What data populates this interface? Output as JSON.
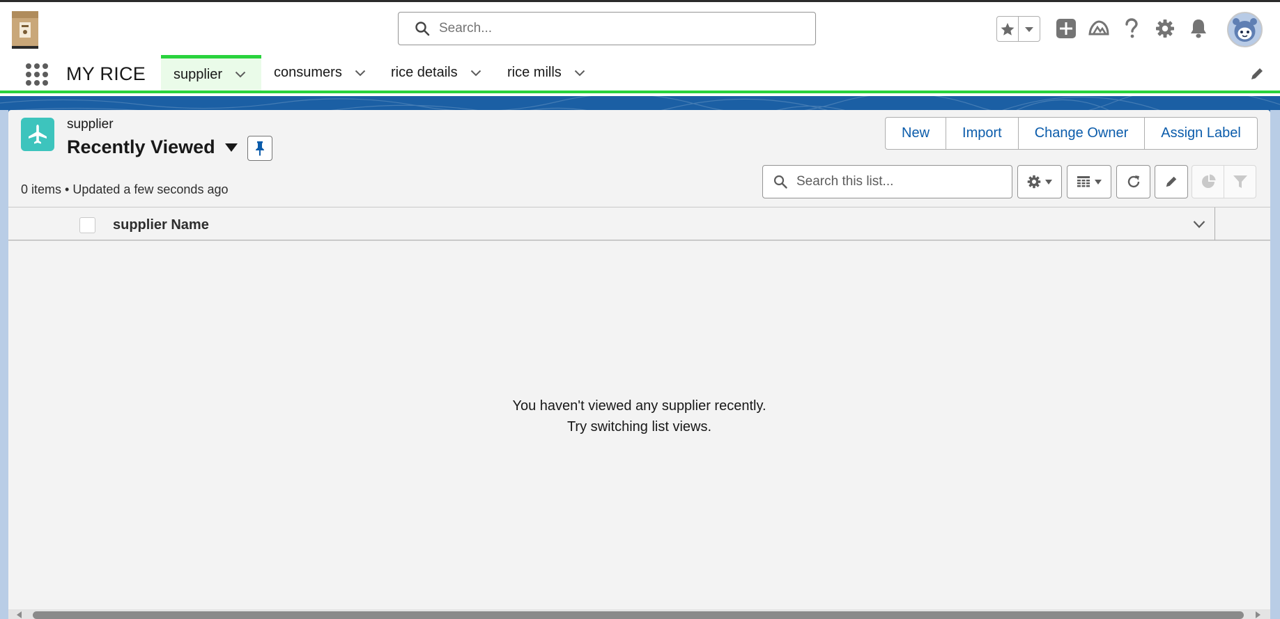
{
  "header": {
    "search_placeholder": "Search...",
    "icons": [
      "favorites-star-icon",
      "favorites-dropdown-icon",
      "global-add-icon",
      "trailhead-icon",
      "help-icon",
      "setup-gear-icon",
      "notifications-bell-icon",
      "user-avatar"
    ]
  },
  "app": {
    "name": "MY RICE",
    "tabs": [
      {
        "label": "supplier",
        "active": true
      },
      {
        "label": "consumers",
        "active": false
      },
      {
        "label": "rice details",
        "active": false
      },
      {
        "label": "rice mills",
        "active": false
      }
    ]
  },
  "list_view": {
    "object_label": "supplier",
    "view_name": "Recently Viewed",
    "actions": [
      "New",
      "Import",
      "Change Owner",
      "Assign Label"
    ],
    "meta": "0 items • Updated a few seconds ago",
    "search_placeholder": "Search this list...",
    "column_header": "supplier Name",
    "empty_line1": "You haven't viewed any supplier recently.",
    "empty_line2": "Try switching list views."
  },
  "colors": {
    "accent_green": "#29d33d",
    "link_blue": "#0b5cab",
    "object_icon_teal": "#3dc4bd",
    "banner_blue": "#1b5fa4"
  }
}
